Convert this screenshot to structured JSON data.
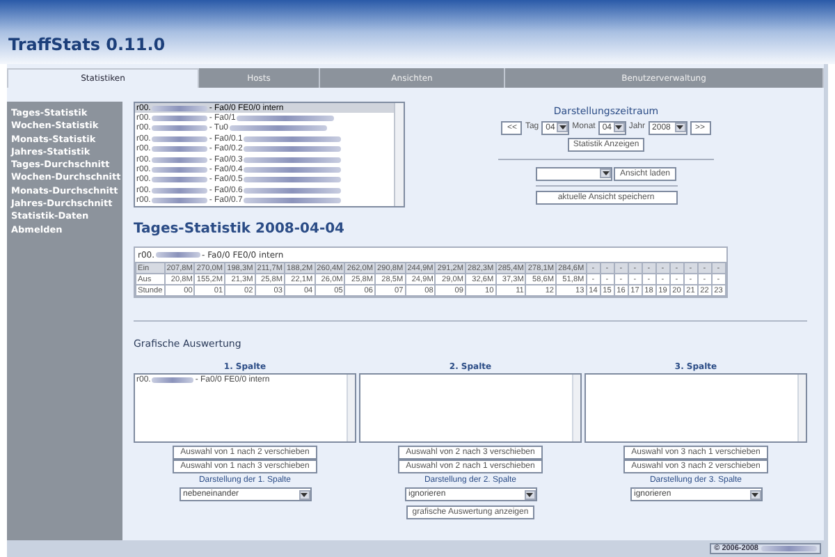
{
  "app": {
    "title": "TraffStats 0.11.0"
  },
  "tabs": [
    {
      "label": "Statistiken",
      "selected": true
    },
    {
      "label": "Hosts",
      "selected": false
    },
    {
      "label": "Ansichten",
      "selected": false
    },
    {
      "label": "Benutzerverwaltung",
      "selected": false
    }
  ],
  "sidebar": {
    "items": [
      "Tages-Statistik",
      "Wochen-Statistik",
      "Monats-Statistik",
      "Jahres-Statistik",
      "Tages-Durchschnitt",
      "Wochen-Durchschnitt",
      "Monats-Durchschnitt",
      "Jahres-Durchschnitt",
      "Statistik-Daten",
      "Abmelden"
    ]
  },
  "interface_list": {
    "items": [
      {
        "prefix": "r00.",
        "suffix": "- Fa0/0 FE0/0 intern",
        "selected": true
      },
      {
        "prefix": "r00.",
        "suffix": "- Fa0/1",
        "selected": false
      },
      {
        "prefix": "r00.",
        "suffix": "- Tu0",
        "selected": false
      },
      {
        "prefix": "r00.",
        "suffix": "- Fa0/0.1",
        "selected": false
      },
      {
        "prefix": "r00.",
        "suffix": "- Fa0/0.2",
        "selected": false
      },
      {
        "prefix": "r00.",
        "suffix": "- Fa0/0.3",
        "selected": false
      },
      {
        "prefix": "r00.",
        "suffix": "- Fa0/0.4",
        "selected": false
      },
      {
        "prefix": "r00.",
        "suffix": "- Fa0/0.5",
        "selected": false
      },
      {
        "prefix": "r00.",
        "suffix": "- Fa0/0.6",
        "selected": false
      },
      {
        "prefix": "r00.",
        "suffix": "- Fa0/0.7",
        "selected": false
      }
    ]
  },
  "period": {
    "title": "Darstellungszeitraum",
    "prev": "<<",
    "day_label": "Tag",
    "day": "04",
    "month_label": "Monat",
    "month": "04",
    "year_label": "Jahr",
    "year": "2008",
    "next": ">>",
    "show_button": "Statistik Anzeigen"
  },
  "view": {
    "load_button": "Ansicht laden",
    "save_button": "aktuelle Ansicht speichern"
  },
  "stats": {
    "heading": "Tages-Statistik 2008-04-04",
    "interface": {
      "prefix": "r00.",
      "suffix": "- Fa0/0 FE0/0 intern"
    },
    "rows": [
      {
        "label": "Ein",
        "cells": [
          "207,8M",
          "270,0M",
          "198,3M",
          "211,7M",
          "188,2M",
          "260,4M",
          "262,0M",
          "290,8M",
          "244,9M",
          "291,2M",
          "282,3M",
          "285,4M",
          "278,1M",
          "284,6M",
          "-",
          "-",
          "-",
          "-",
          "-",
          "-",
          "-",
          "-",
          "-",
          "-"
        ]
      },
      {
        "label": "Aus",
        "cells": [
          "20,8M",
          "155,2M",
          "21,3M",
          "25,8M",
          "22,1M",
          "26,0M",
          "25,8M",
          "28,5M",
          "24,9M",
          "29,0M",
          "32,6M",
          "37,3M",
          "58,6M",
          "51,8M",
          "-",
          "-",
          "-",
          "-",
          "-",
          "-",
          "-",
          "-",
          "-",
          "-"
        ]
      },
      {
        "label": "Stunde",
        "cells": [
          "00",
          "01",
          "02",
          "03",
          "04",
          "05",
          "06",
          "07",
          "08",
          "09",
          "10",
          "11",
          "12",
          "13",
          "14",
          "15",
          "16",
          "17",
          "18",
          "19",
          "20",
          "21",
          "22",
          "23"
        ]
      }
    ]
  },
  "graphic": {
    "heading": "Grafische Auswertung",
    "columns": [
      {
        "title": "1. Spalte",
        "items": [
          {
            "prefix": "r00.",
            "suffix": "- Fa0/0 FE0/0 intern"
          }
        ],
        "buttons": [
          "Auswahl von 1 nach 2 verschieben",
          "Auswahl von 1 nach 3 verschieben"
        ],
        "display_label": "Darstellung der 1. Spalte",
        "display_value": "nebeneinander"
      },
      {
        "title": "2. Spalte",
        "buttons": [
          "Auswahl von 2 nach 3 verschieben",
          "Auswahl von 2 nach 1 verschieben"
        ],
        "display_label": "Darstellung der 2. Spalte",
        "display_value": "ignorieren"
      },
      {
        "title": "3. Spalte",
        "buttons": [
          "Auswahl von 3 nach 1 verschieben",
          "Auswahl von 3 nach 2 verschieben"
        ],
        "display_label": "Darstellung der 3. Spalte",
        "display_value": "ignorieren"
      }
    ],
    "show_button": "grafische Auswertung anzeigen"
  },
  "footer": {
    "copyright": "© 2006-2008"
  }
}
